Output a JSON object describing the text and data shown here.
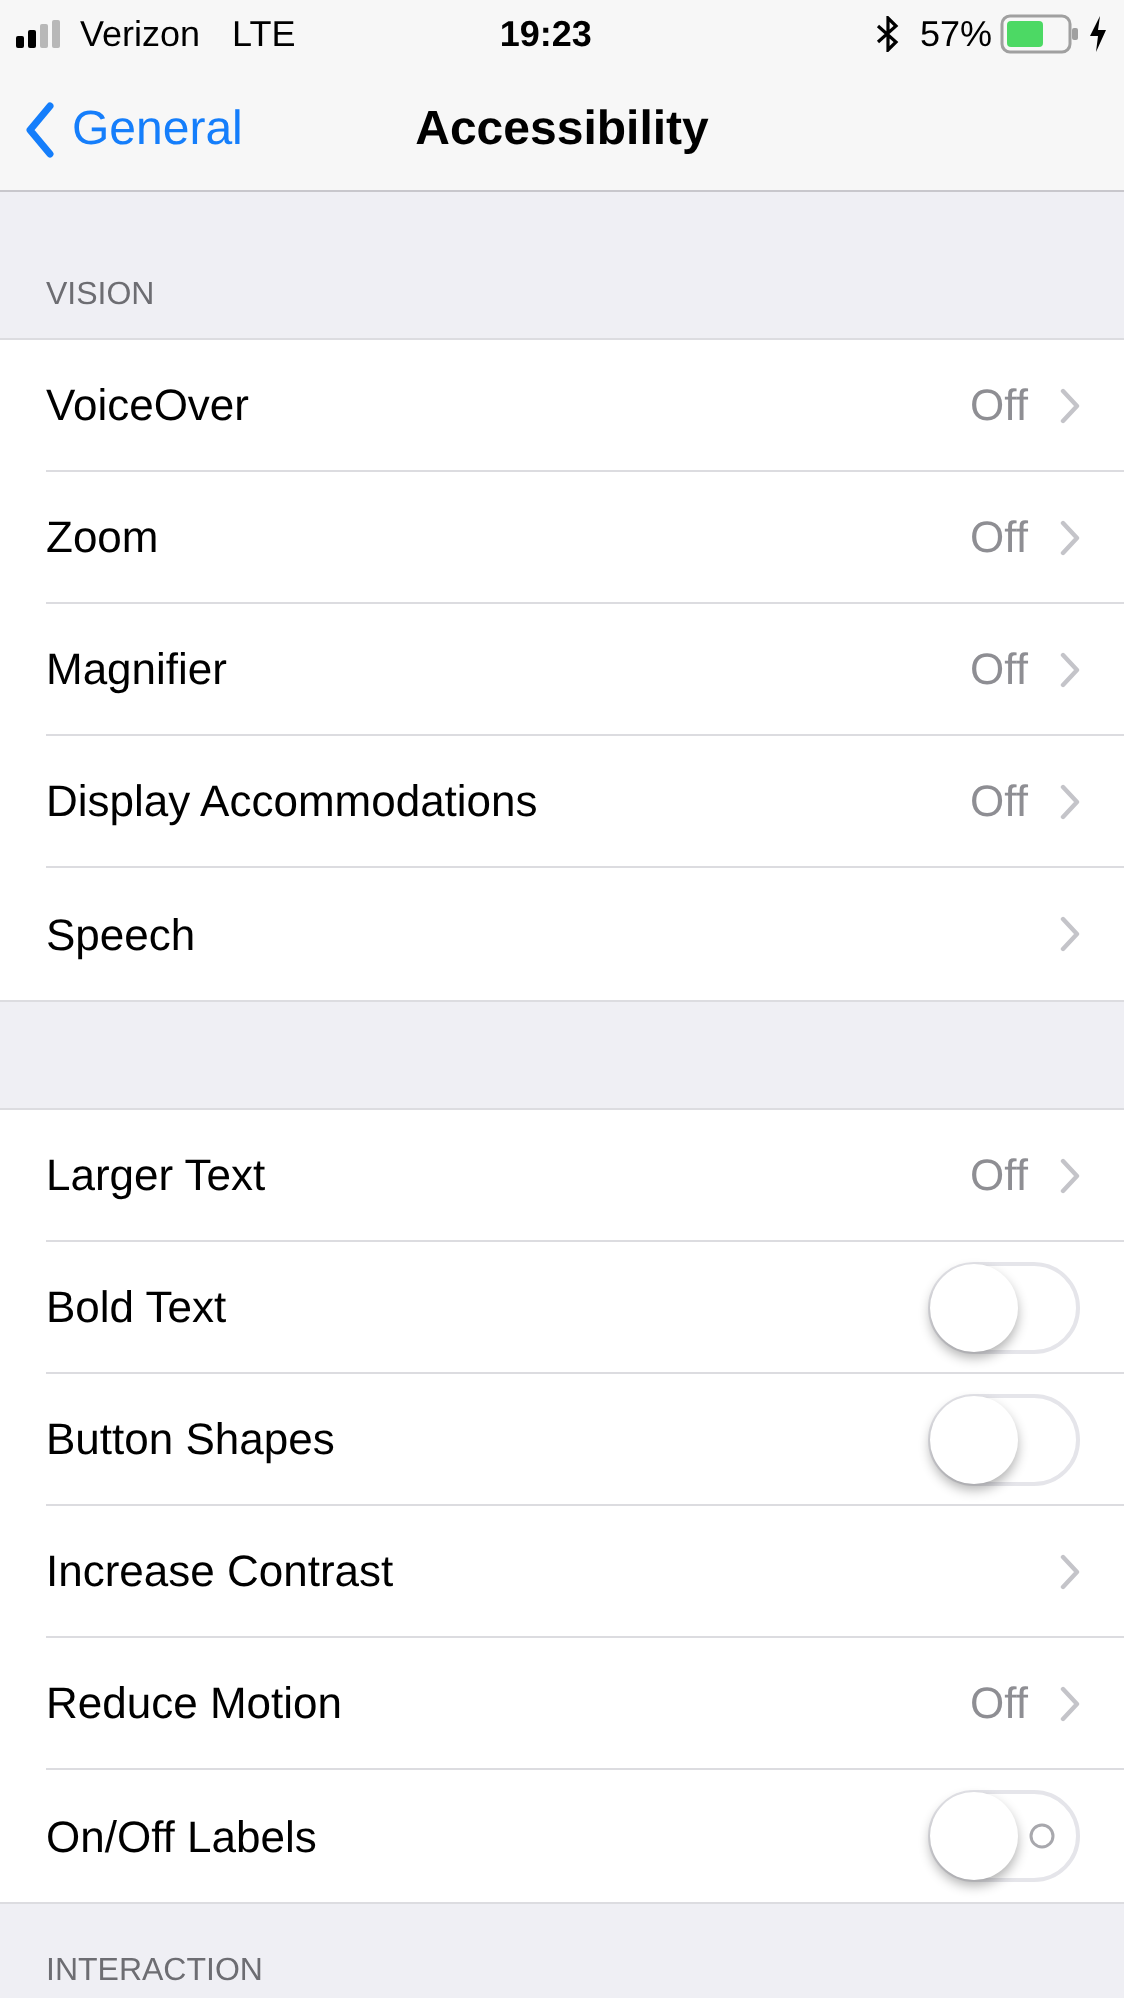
{
  "status_bar": {
    "carrier": "Verizon",
    "network": "LTE",
    "time": "19:23",
    "battery": "57%"
  },
  "nav": {
    "back": "General",
    "title": "Accessibility"
  },
  "sections": [
    {
      "header": "VISION",
      "rows": [
        {
          "kind": "link",
          "label": "VoiceOver",
          "value": "Off"
        },
        {
          "kind": "link",
          "label": "Zoom",
          "value": "Off"
        },
        {
          "kind": "link",
          "label": "Magnifier",
          "value": "Off"
        },
        {
          "kind": "link",
          "label": "Display Accommodations",
          "value": "Off"
        },
        {
          "kind": "link",
          "label": "Speech"
        }
      ]
    },
    {
      "rows": [
        {
          "kind": "link",
          "label": "Larger Text",
          "value": "Off"
        },
        {
          "kind": "toggle",
          "label": "Bold Text",
          "on": false,
          "labels": false
        },
        {
          "kind": "toggle",
          "label": "Button Shapes",
          "on": false,
          "labels": false
        },
        {
          "kind": "link",
          "label": "Increase Contrast"
        },
        {
          "kind": "link",
          "label": "Reduce Motion",
          "value": "Off"
        },
        {
          "kind": "toggle",
          "label": "On/Off Labels",
          "on": false,
          "labels": true
        }
      ]
    },
    {
      "header": "INTERACTION"
    }
  ]
}
